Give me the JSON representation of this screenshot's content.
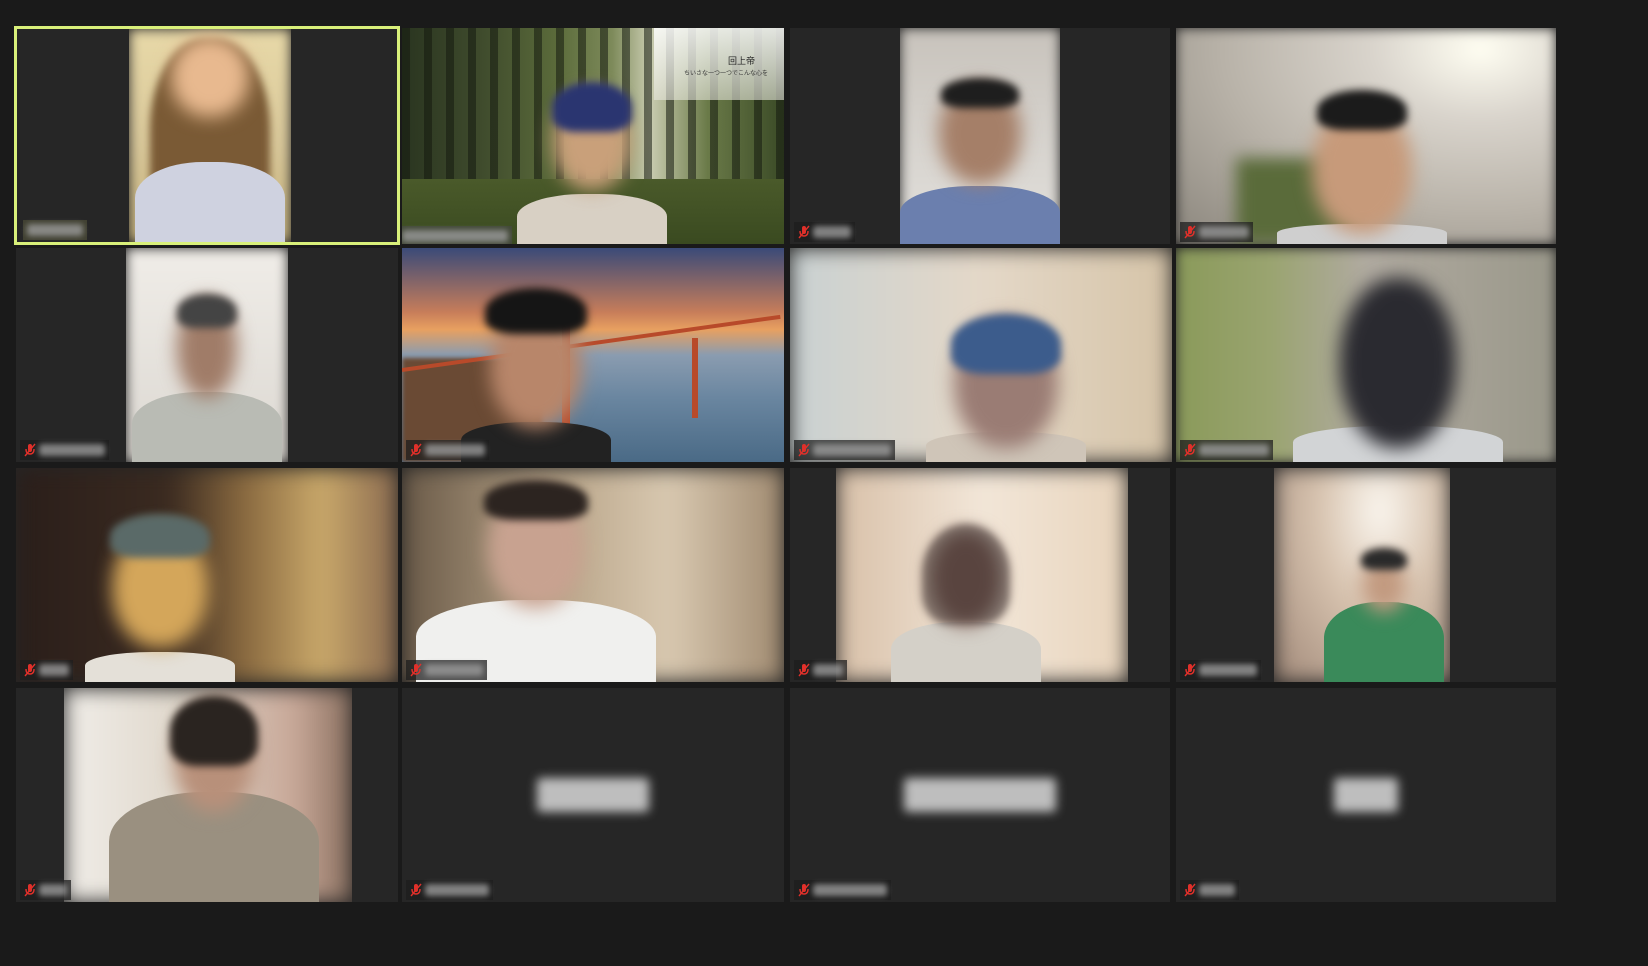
{
  "app": {
    "view": "gallery-view",
    "background_color": "#1a1a1a",
    "active_speaker_border_color": "#d9f07a",
    "muted_icon_color": "#e0302a"
  },
  "participants": [
    {
      "id": "p1",
      "name": "",
      "muted": false,
      "video": true,
      "active_speaker": true,
      "background": "home-wall",
      "name_redacted": true
    },
    {
      "id": "p2",
      "name": "",
      "muted": false,
      "video": true,
      "active_speaker": false,
      "background": "virtual-forest",
      "name_redacted": true,
      "background_caption": "回上帝",
      "background_subcaption": "ちいさな一つ一つでこんな心を"
    },
    {
      "id": "p3",
      "name": "",
      "muted": true,
      "video": true,
      "active_speaker": false,
      "background": "plain-wall",
      "name_redacted": true
    },
    {
      "id": "p4",
      "name": "",
      "muted": true,
      "video": true,
      "active_speaker": false,
      "background": "room-with-ceiling-light",
      "name_redacted": true
    },
    {
      "id": "p5",
      "name": "",
      "muted": true,
      "video": true,
      "active_speaker": false,
      "background": "white-wall",
      "name_redacted": true
    },
    {
      "id": "p6",
      "name": "",
      "muted": true,
      "video": true,
      "active_speaker": false,
      "background": "virtual-golden-gate-bridge",
      "name_redacted": true
    },
    {
      "id": "p7",
      "name": "",
      "muted": true,
      "video": true,
      "active_speaker": false,
      "background": "blurred-room",
      "name_redacted": true
    },
    {
      "id": "p8",
      "name": "",
      "muted": true,
      "video": true,
      "active_speaker": false,
      "background": "room-with-curtains",
      "name_redacted": true
    },
    {
      "id": "p9",
      "name": "",
      "muted": true,
      "video": true,
      "active_speaker": false,
      "background": "dark-warm-room",
      "name_redacted": true
    },
    {
      "id": "p10",
      "name": "",
      "muted": true,
      "video": true,
      "active_speaker": false,
      "background": "warm-blurred-room",
      "name_redacted": true
    },
    {
      "id": "p11",
      "name": "",
      "muted": true,
      "video": true,
      "active_speaker": false,
      "background": "bright-room",
      "name_redacted": true
    },
    {
      "id": "p12",
      "name": "",
      "muted": true,
      "video": true,
      "active_speaker": false,
      "background": "lamp-room",
      "name_redacted": true
    },
    {
      "id": "p13",
      "name": "",
      "muted": true,
      "video": true,
      "active_speaker": false,
      "background": "light-room",
      "name_redacted": true
    },
    {
      "id": "p14",
      "name": "",
      "muted": true,
      "video": false,
      "active_speaker": false,
      "background": "none",
      "name_redacted": true
    },
    {
      "id": "p15",
      "name": "",
      "muted": true,
      "video": false,
      "active_speaker": false,
      "background": "none",
      "name_redacted": true
    },
    {
      "id": "p16",
      "name": "",
      "muted": true,
      "video": false,
      "active_speaker": false,
      "background": "none",
      "name_redacted": true
    }
  ],
  "icons": {
    "muted_mic": "mic-muted-icon"
  }
}
